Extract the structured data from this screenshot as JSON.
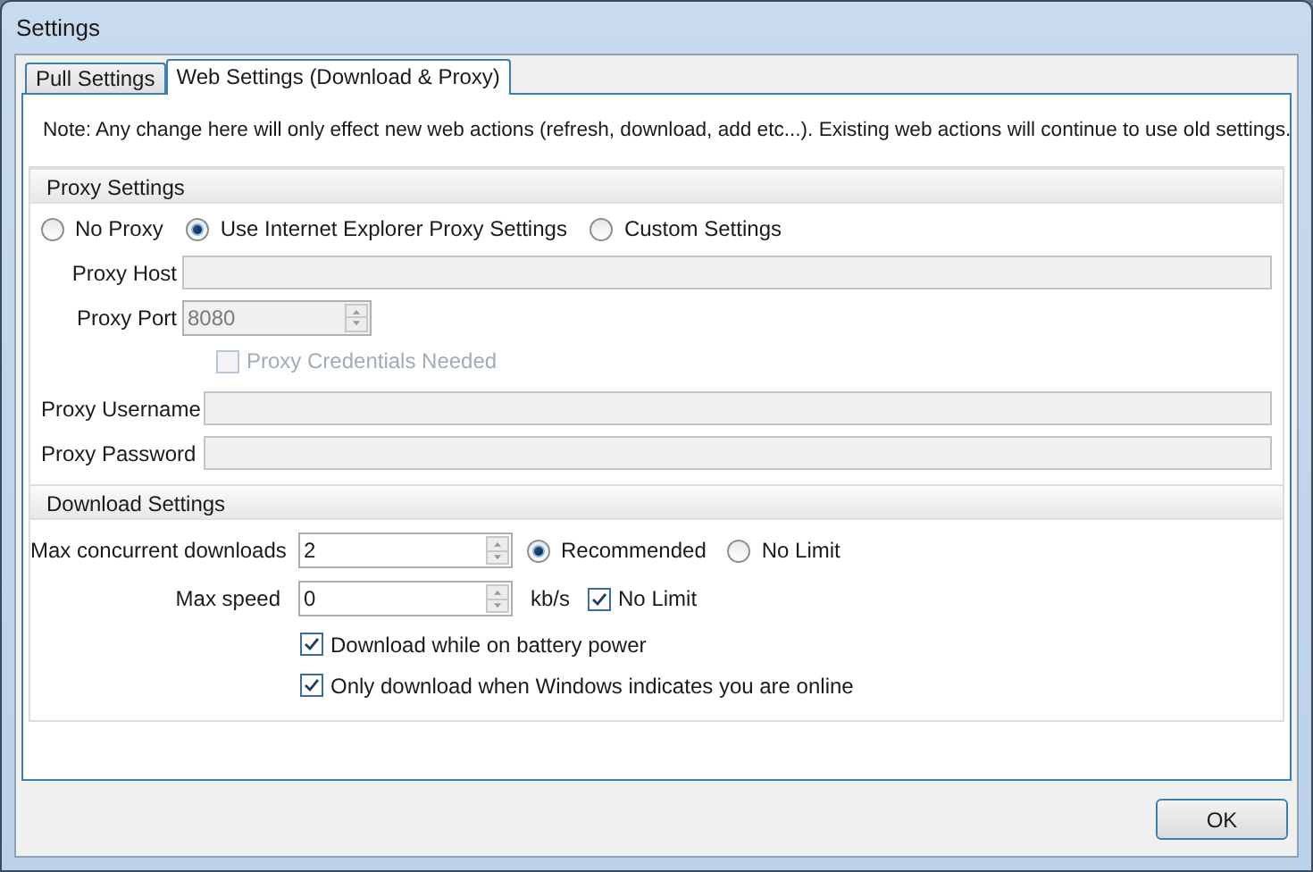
{
  "window": {
    "title": "Settings"
  },
  "tabs": [
    {
      "label": "Pull Settings",
      "selected": false
    },
    {
      "label": "Web Settings (Download & Proxy)",
      "selected": true
    }
  ],
  "note": "Note: Any change here will only effect new web actions (refresh, download, add etc...). Existing web actions will continue to use old settings.",
  "proxy": {
    "title": "Proxy Settings",
    "modes": [
      {
        "label": "No Proxy",
        "selected": false
      },
      {
        "label": "Use Internet Explorer Proxy Settings",
        "selected": true
      },
      {
        "label": "Custom Settings",
        "selected": false
      }
    ],
    "host": {
      "label": "Proxy Host",
      "disabled": true
    },
    "port": {
      "label": "Proxy Port",
      "value": "8080",
      "disabled": true
    },
    "credentials": {
      "label": "Proxy Credentials Needed",
      "checked": false,
      "disabled": true
    },
    "username": {
      "label": "Proxy Username",
      "disabled": true
    },
    "password": {
      "label": "Proxy Password",
      "disabled": true
    }
  },
  "download": {
    "title": "Download Settings",
    "concurrent": {
      "label": "Max concurrent downloads",
      "value": "2",
      "options": [
        {
          "label": "Recommended",
          "selected": true
        },
        {
          "label": "No Limit",
          "selected": false
        }
      ]
    },
    "speed": {
      "label": "Max speed",
      "value": "0",
      "unit": "kb/s",
      "no_limit": {
        "label": "No Limit",
        "checked": true
      }
    },
    "options": [
      {
        "label": "Download while on battery power",
        "checked": true
      },
      {
        "label": "Only download when Windows indicates you are online",
        "checked": true
      }
    ]
  },
  "buttons": [
    "OK"
  ]
}
